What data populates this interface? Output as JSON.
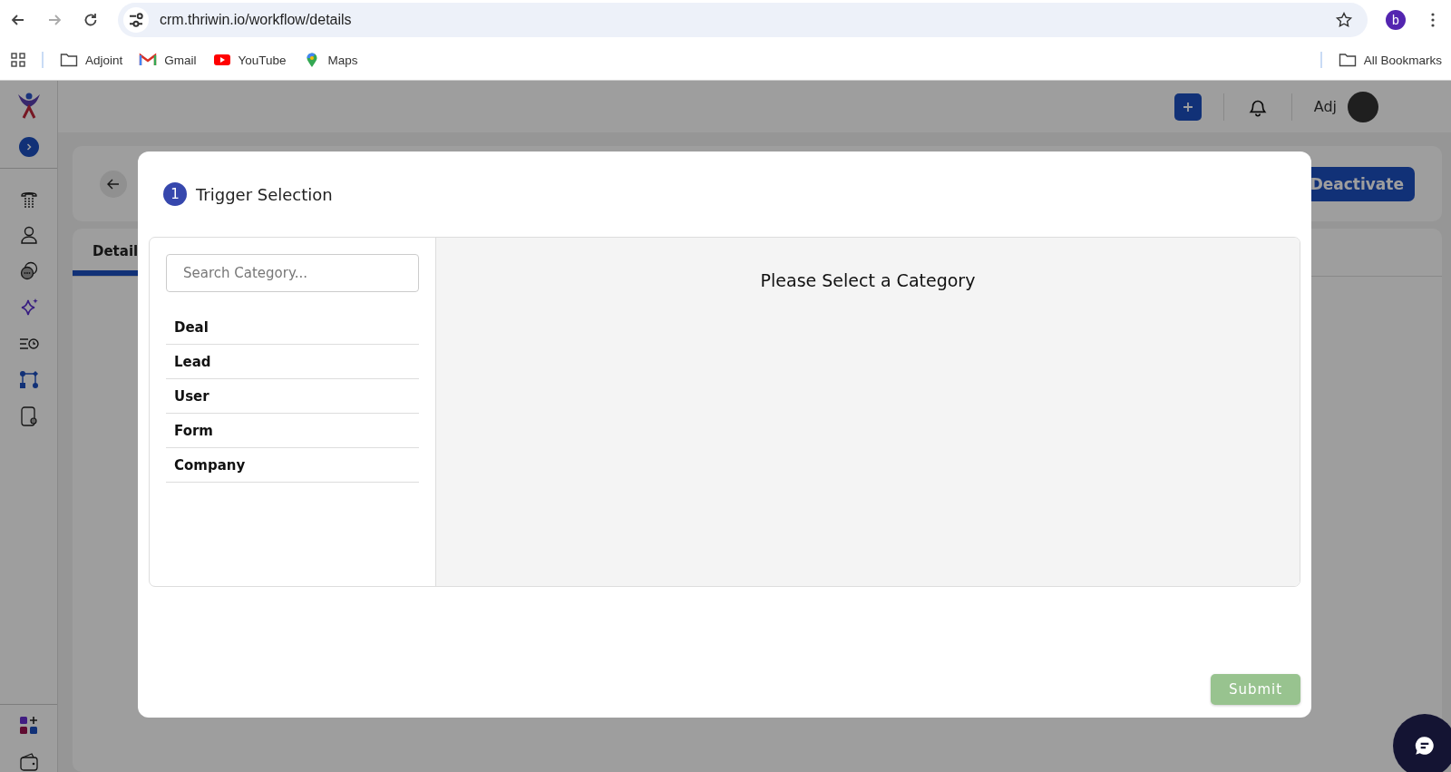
{
  "browser": {
    "url": "crm.thriwin.io/workflow/details",
    "profile": "b",
    "bookmarks": [
      {
        "kind": "folder",
        "label": "Adjoint"
      },
      {
        "kind": "gmail",
        "label": "Gmail"
      },
      {
        "kind": "youtube",
        "label": "YouTube"
      },
      {
        "kind": "maps",
        "label": "Maps"
      }
    ],
    "all_bookmarks": "All Bookmarks"
  },
  "header": {
    "user": "Adj"
  },
  "page": {
    "action_button": "Deactivate",
    "tabs": [
      {
        "label": "Detail",
        "selected": true
      }
    ]
  },
  "modal": {
    "step": "1",
    "title": "Trigger Selection",
    "search": {
      "placeholder": "Search Category..."
    },
    "categories": [
      {
        "label": "Deal",
        "selected": false
      },
      {
        "label": "Lead",
        "selected": false
      },
      {
        "label": "User",
        "selected": false
      },
      {
        "label": "Form",
        "selected": false
      },
      {
        "label": "Company",
        "selected": false
      }
    ],
    "empty_message": "Please Select a Category",
    "submit": {
      "label": "Submit",
      "disabled": true
    }
  }
}
